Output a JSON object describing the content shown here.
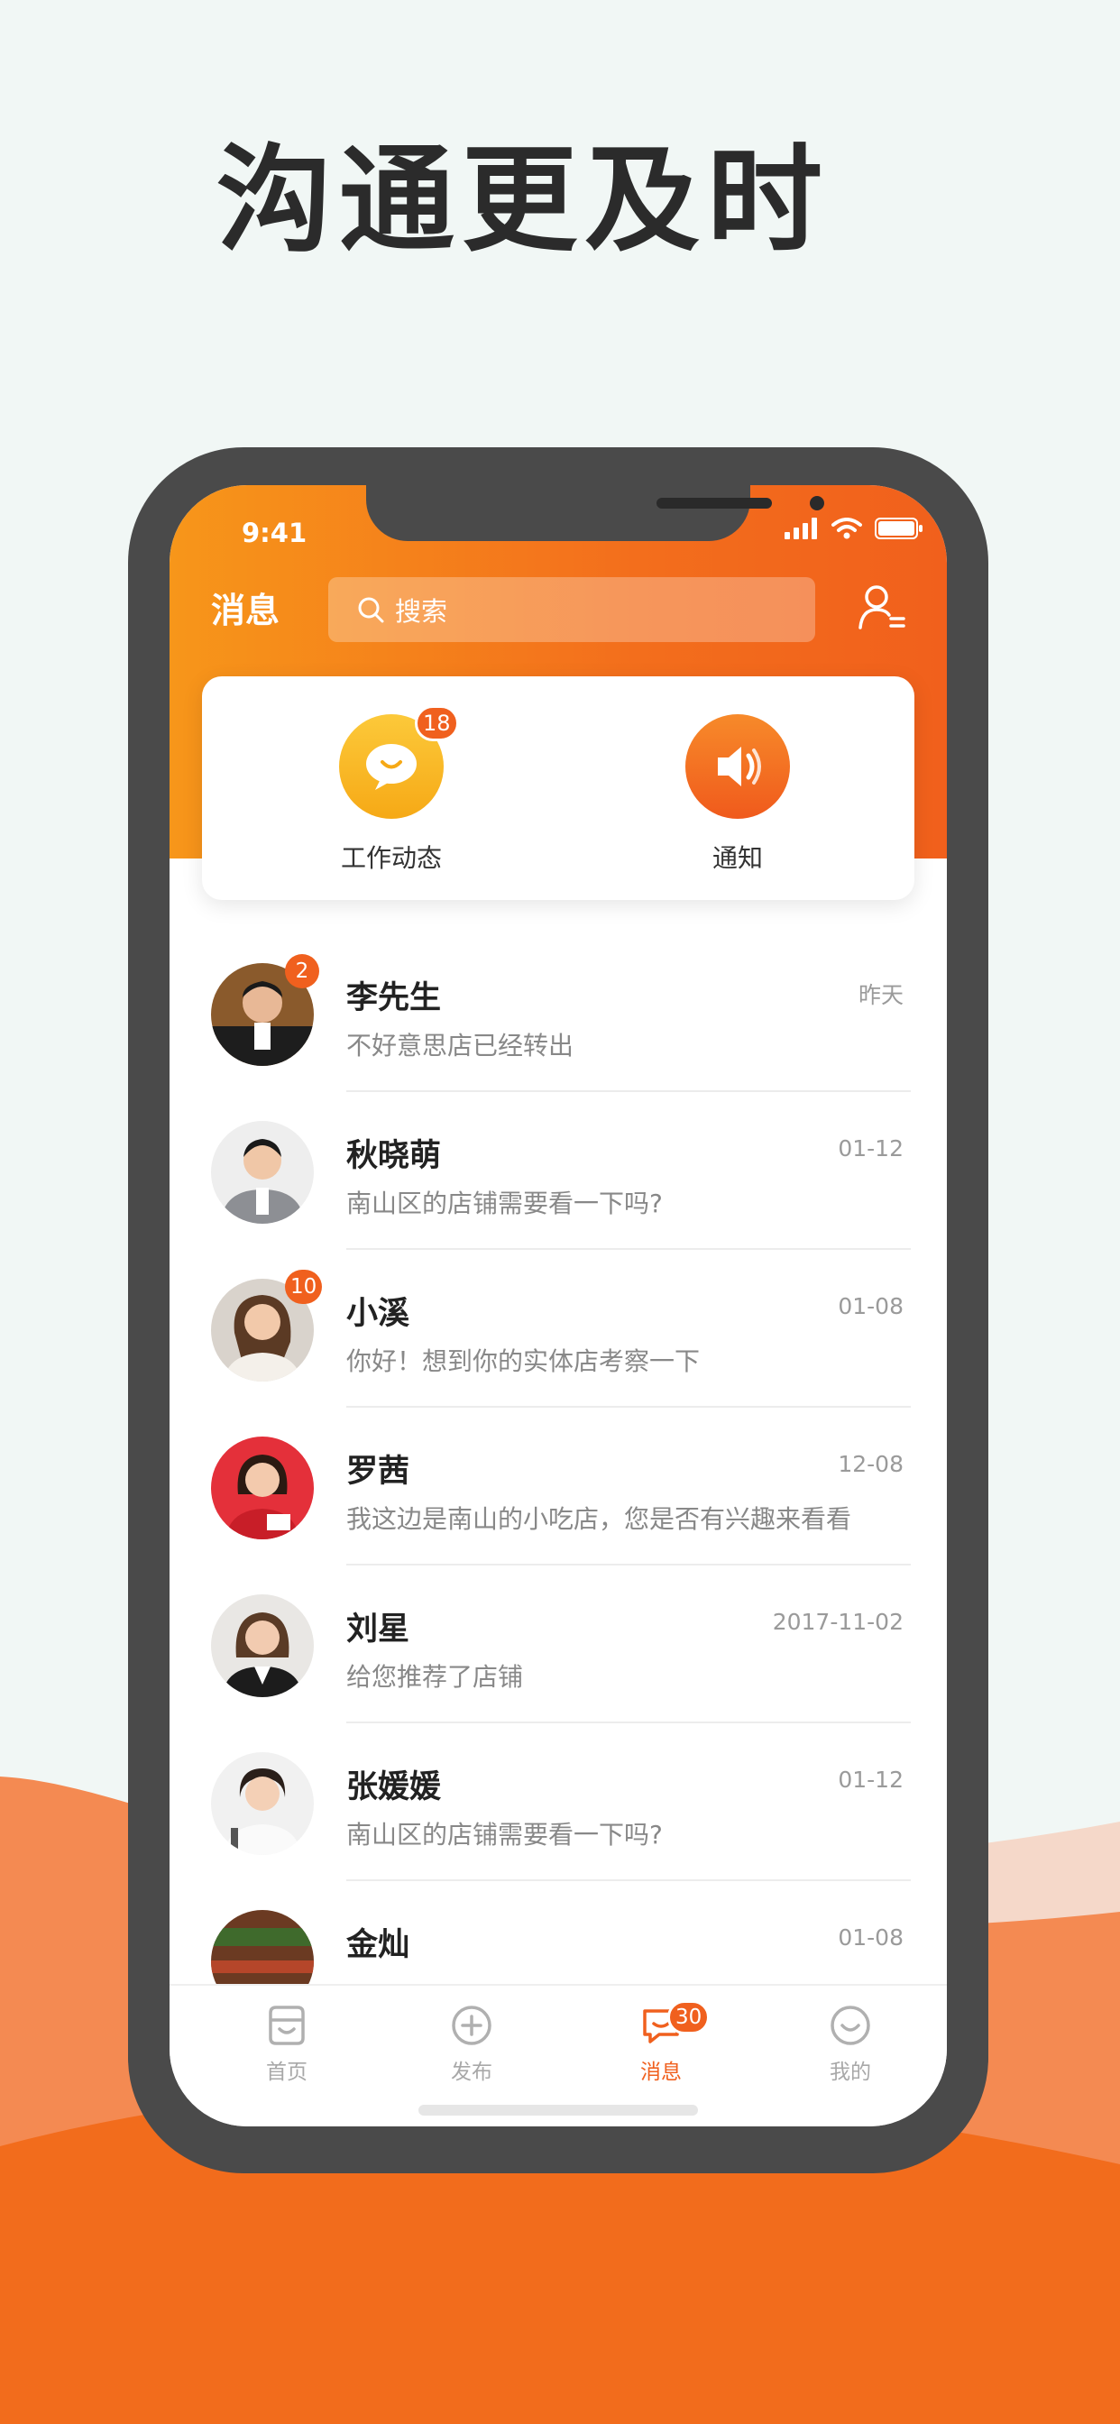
{
  "headline": "沟通更及时",
  "status_bar": {
    "time": "9:41"
  },
  "nav": {
    "title": "消息",
    "search_placeholder": "搜索"
  },
  "quick_actions": [
    {
      "label": "工作动态",
      "icon": "chat-bubble-icon",
      "badge": "18",
      "color": "#f9b51f"
    },
    {
      "label": "通知",
      "icon": "speaker-icon",
      "badge": "",
      "color": "#f36a1c"
    }
  ],
  "messages": [
    {
      "name": "李先生",
      "time": "昨天",
      "preview": "不好意思店已经转出",
      "unread": "2"
    },
    {
      "name": "秋晓萌",
      "time": "01-12",
      "preview": "南山区的店铺需要看一下吗?",
      "unread": ""
    },
    {
      "name": "小溪",
      "time": "01-08",
      "preview": "你好！想到你的实体店考察一下",
      "unread": "10"
    },
    {
      "name": "罗茜",
      "time": "12-08",
      "preview": "我这边是南山的小吃店，您是否有兴趣来看看",
      "unread": ""
    },
    {
      "name": "刘星",
      "time": "2017-11-02",
      "preview": "给您推荐了店铺",
      "unread": ""
    },
    {
      "name": "张媛媛",
      "time": "01-12",
      "preview": "南山区的店铺需要看一下吗?",
      "unread": ""
    },
    {
      "name": "金灿",
      "time": "01-08",
      "preview": "",
      "unread": ""
    }
  ],
  "tabbar": [
    {
      "label": "首页",
      "icon": "home-icon",
      "active": false,
      "badge": ""
    },
    {
      "label": "发布",
      "icon": "plus-circle-icon",
      "active": false,
      "badge": ""
    },
    {
      "label": "消息",
      "icon": "message-icon",
      "active": true,
      "badge": "30"
    },
    {
      "label": "我的",
      "icon": "smile-icon",
      "active": false,
      "badge": ""
    }
  ],
  "colors": {
    "accent": "#f0601e",
    "gradient_start": "#f7961a",
    "gradient_end": "#f1601c",
    "background": "#f1f7f5"
  }
}
